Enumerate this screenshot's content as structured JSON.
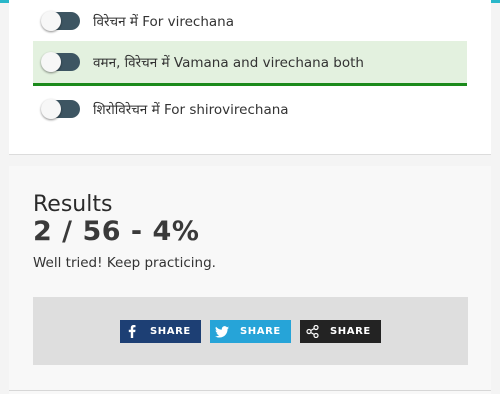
{
  "quiz": {
    "options": [
      {
        "label": "विरेचन में For virechana",
        "selected": false
      },
      {
        "label": "वमन, विरेचन में Vamana and virechana both",
        "selected": true
      },
      {
        "label": "शिरोविरेचन में For shirovirechana",
        "selected": false
      }
    ]
  },
  "results": {
    "title": "Results",
    "score": "2 / 56 - 4%",
    "message": "Well tried! Keep practicing."
  },
  "share": {
    "facebook": {
      "label": "SHARE",
      "icon": "facebook-icon"
    },
    "twitter": {
      "label": "SHARE",
      "icon": "twitter-icon"
    },
    "generic": {
      "label": "SHARE",
      "icon": "share-icon"
    }
  },
  "colors": {
    "accent": "#2ab7c9",
    "toggle_track": "#3d5562",
    "selected_background": "#e3f1df",
    "selected_border": "#1b8a1b",
    "facebook": "#1d3f74",
    "twitter": "#26a4d8",
    "generic_share": "#232323"
  }
}
